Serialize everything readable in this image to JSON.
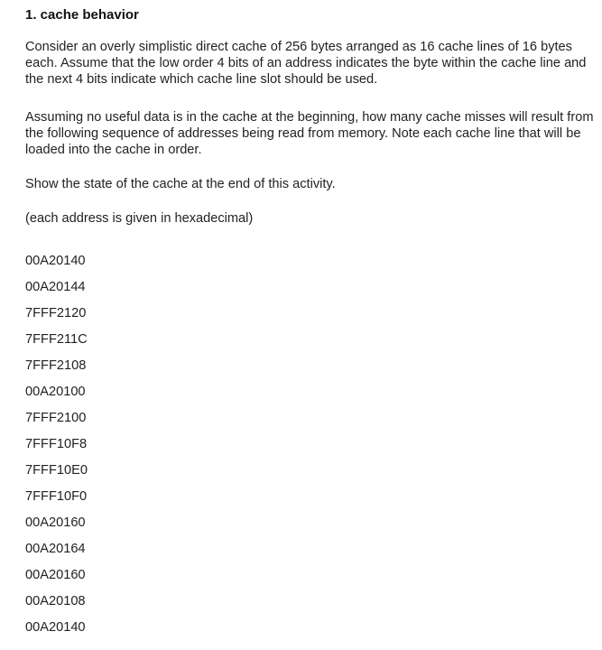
{
  "title": "1. cache behavior",
  "paragraphs": [
    "Consider an overly simplistic direct cache of 256 bytes arranged as 16 cache lines of 16 bytes each. Assume that the low order 4 bits of an address indicates the byte within the cache line and the next 4 bits indicate which cache line slot should be used.",
    "Assuming no useful data is in the cache at the beginning, how many cache misses will result from the following sequence of addresses being read from memory. Note each cache line that will be loaded into the cache in order.",
    "Show the state of the cache at the end of this activity.",
    "(each address is given in hexadecimal)"
  ],
  "addresses": [
    "00A20140",
    "00A20144",
    "7FFF2120",
    "7FFF211C",
    "7FFF2108",
    "00A20100",
    "7FFF2100",
    "7FFF10F8",
    "7FFF10E0",
    "7FFF10F0",
    "00A20160",
    "00A20164",
    "00A20160",
    "00A20108",
    "00A20140"
  ]
}
